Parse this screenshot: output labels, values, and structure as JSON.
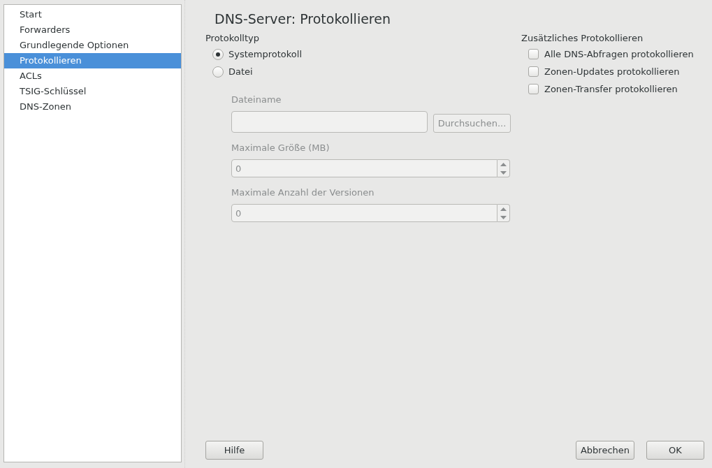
{
  "sidebar": {
    "items": [
      {
        "label": "Start",
        "selected": false
      },
      {
        "label": "Forwarders",
        "selected": false
      },
      {
        "label": "Grundlegende Optionen",
        "selected": false
      },
      {
        "label": "Protokollieren",
        "selected": true
      },
      {
        "label": "ACLs",
        "selected": false
      },
      {
        "label": "TSIG-Schlüssel",
        "selected": false
      },
      {
        "label": "DNS-Zonen",
        "selected": false
      }
    ]
  },
  "title": "DNS-Server: Protokollieren",
  "log_type": {
    "heading": "Protokolltyp",
    "options": [
      {
        "label": "Systemprotokoll",
        "selected": true
      },
      {
        "label": "Datei",
        "selected": false
      }
    ]
  },
  "file_settings": {
    "disabled": true,
    "filename": {
      "label": "Dateiname",
      "browse_button": "Durchsuchen..."
    },
    "max_size": {
      "label": "Maximale Größe (MB)",
      "value": "0"
    },
    "max_versions": {
      "label": "Maximale Anzahl der Versionen",
      "value": "0"
    }
  },
  "additional_logging": {
    "heading": "Zusätzliches Protokollieren",
    "options": [
      {
        "label": "Alle DNS-Abfragen protokollieren",
        "checked": false
      },
      {
        "label": "Zonen-Updates protokollieren",
        "checked": false
      },
      {
        "label": "Zonen-Transfer protokollieren",
        "checked": false
      }
    ]
  },
  "buttons": {
    "help": "Hilfe",
    "cancel": "Abbrechen",
    "ok": "OK"
  }
}
